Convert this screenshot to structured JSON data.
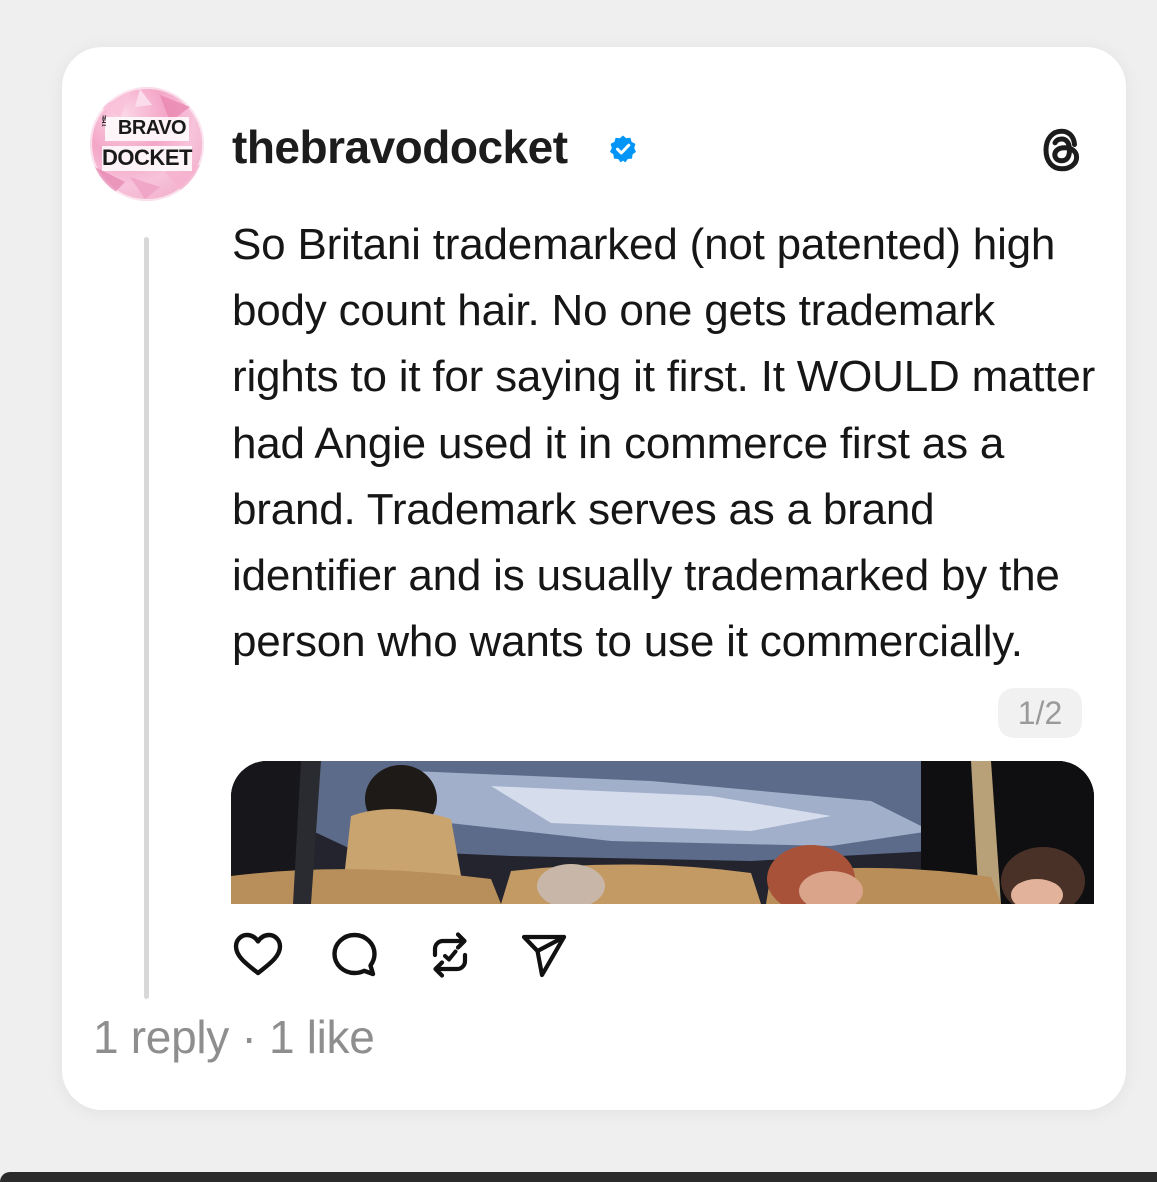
{
  "post": {
    "username": "thebravodocket",
    "verified": true,
    "avatar": {
      "line1": "BRAVO",
      "line2": "DOCKET",
      "vertical": "THE"
    },
    "text": "So Britani trademarked (not patented) high body count hair. No one gets trademark rights to it for saying it first. It WOULD matter had Angie used it in commerce first as a brand. Trademark serves as a brand identifier and is usually trademarked by the person who wants to use it commercially.",
    "page_indicator": "1/2",
    "stats": "1 reply · 1 like"
  },
  "icons": {
    "brand": "threads-logo-icon",
    "verified": "verified-badge-icon",
    "like": "heart-icon",
    "comment": "comment-icon",
    "repost": "repost-icon",
    "share": "send-icon"
  },
  "colors": {
    "verified": "#0095f6",
    "text": "#161616",
    "muted": "#8e8e8e",
    "card": "#ffffff",
    "background": "#efefef"
  }
}
